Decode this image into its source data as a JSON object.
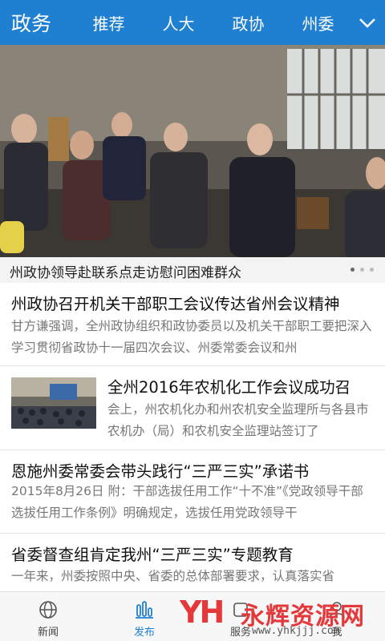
{
  "header": {
    "title": "政务",
    "tabs": [
      "推荐",
      "人大",
      "政协",
      "州委"
    ]
  },
  "featured": {
    "caption": "州政协领导赴联系点走访慰问困难群众",
    "page_dots": 3,
    "active_dot": 1
  },
  "news": [
    {
      "headline": "州政协召开机关干部职工会议传达省州会议精神",
      "summary": "甘方谦强调，全州政协组织和政协委员以及机关干部职工要把深入学习贯彻省政协十一届四次会议、州委常委会议和州"
    },
    {
      "headline": "全州2016年农机化工作会议成功召",
      "summary": "会上，州农机化办和州农机安全监理所与各县市农机办（局）和农机安全监理站签订了"
    },
    {
      "headline": "恩施州委常委会带头践行“三严三实”承诺书",
      "summary": "2015年8月26日 附：干部选拔任用工作“十不准”《党政领导干部选拔任用工作条例》明确规定，选拔任用党政领导干"
    },
    {
      "headline": "省委督查组肯定我州“三严三实”专题教育",
      "summary": "一年来，州委按照中央、省委的总体部署要求，认真落实省"
    }
  ],
  "bottom_nav": {
    "items": [
      {
        "label": "新闻",
        "icon": "globe-icon"
      },
      {
        "label": "发布",
        "icon": "bar-chart-icon"
      },
      {
        "label": "服务",
        "icon": "service-icon"
      },
      {
        "label": "我",
        "icon": "user-icon"
      }
    ],
    "active": "发布"
  },
  "watermark": {
    "logo": "YH",
    "text": "永辉资源网",
    "url": "www.yhkjjj.com"
  },
  "colors": {
    "primary": "#1f7fd0",
    "watermark_red": "#e5383b"
  }
}
